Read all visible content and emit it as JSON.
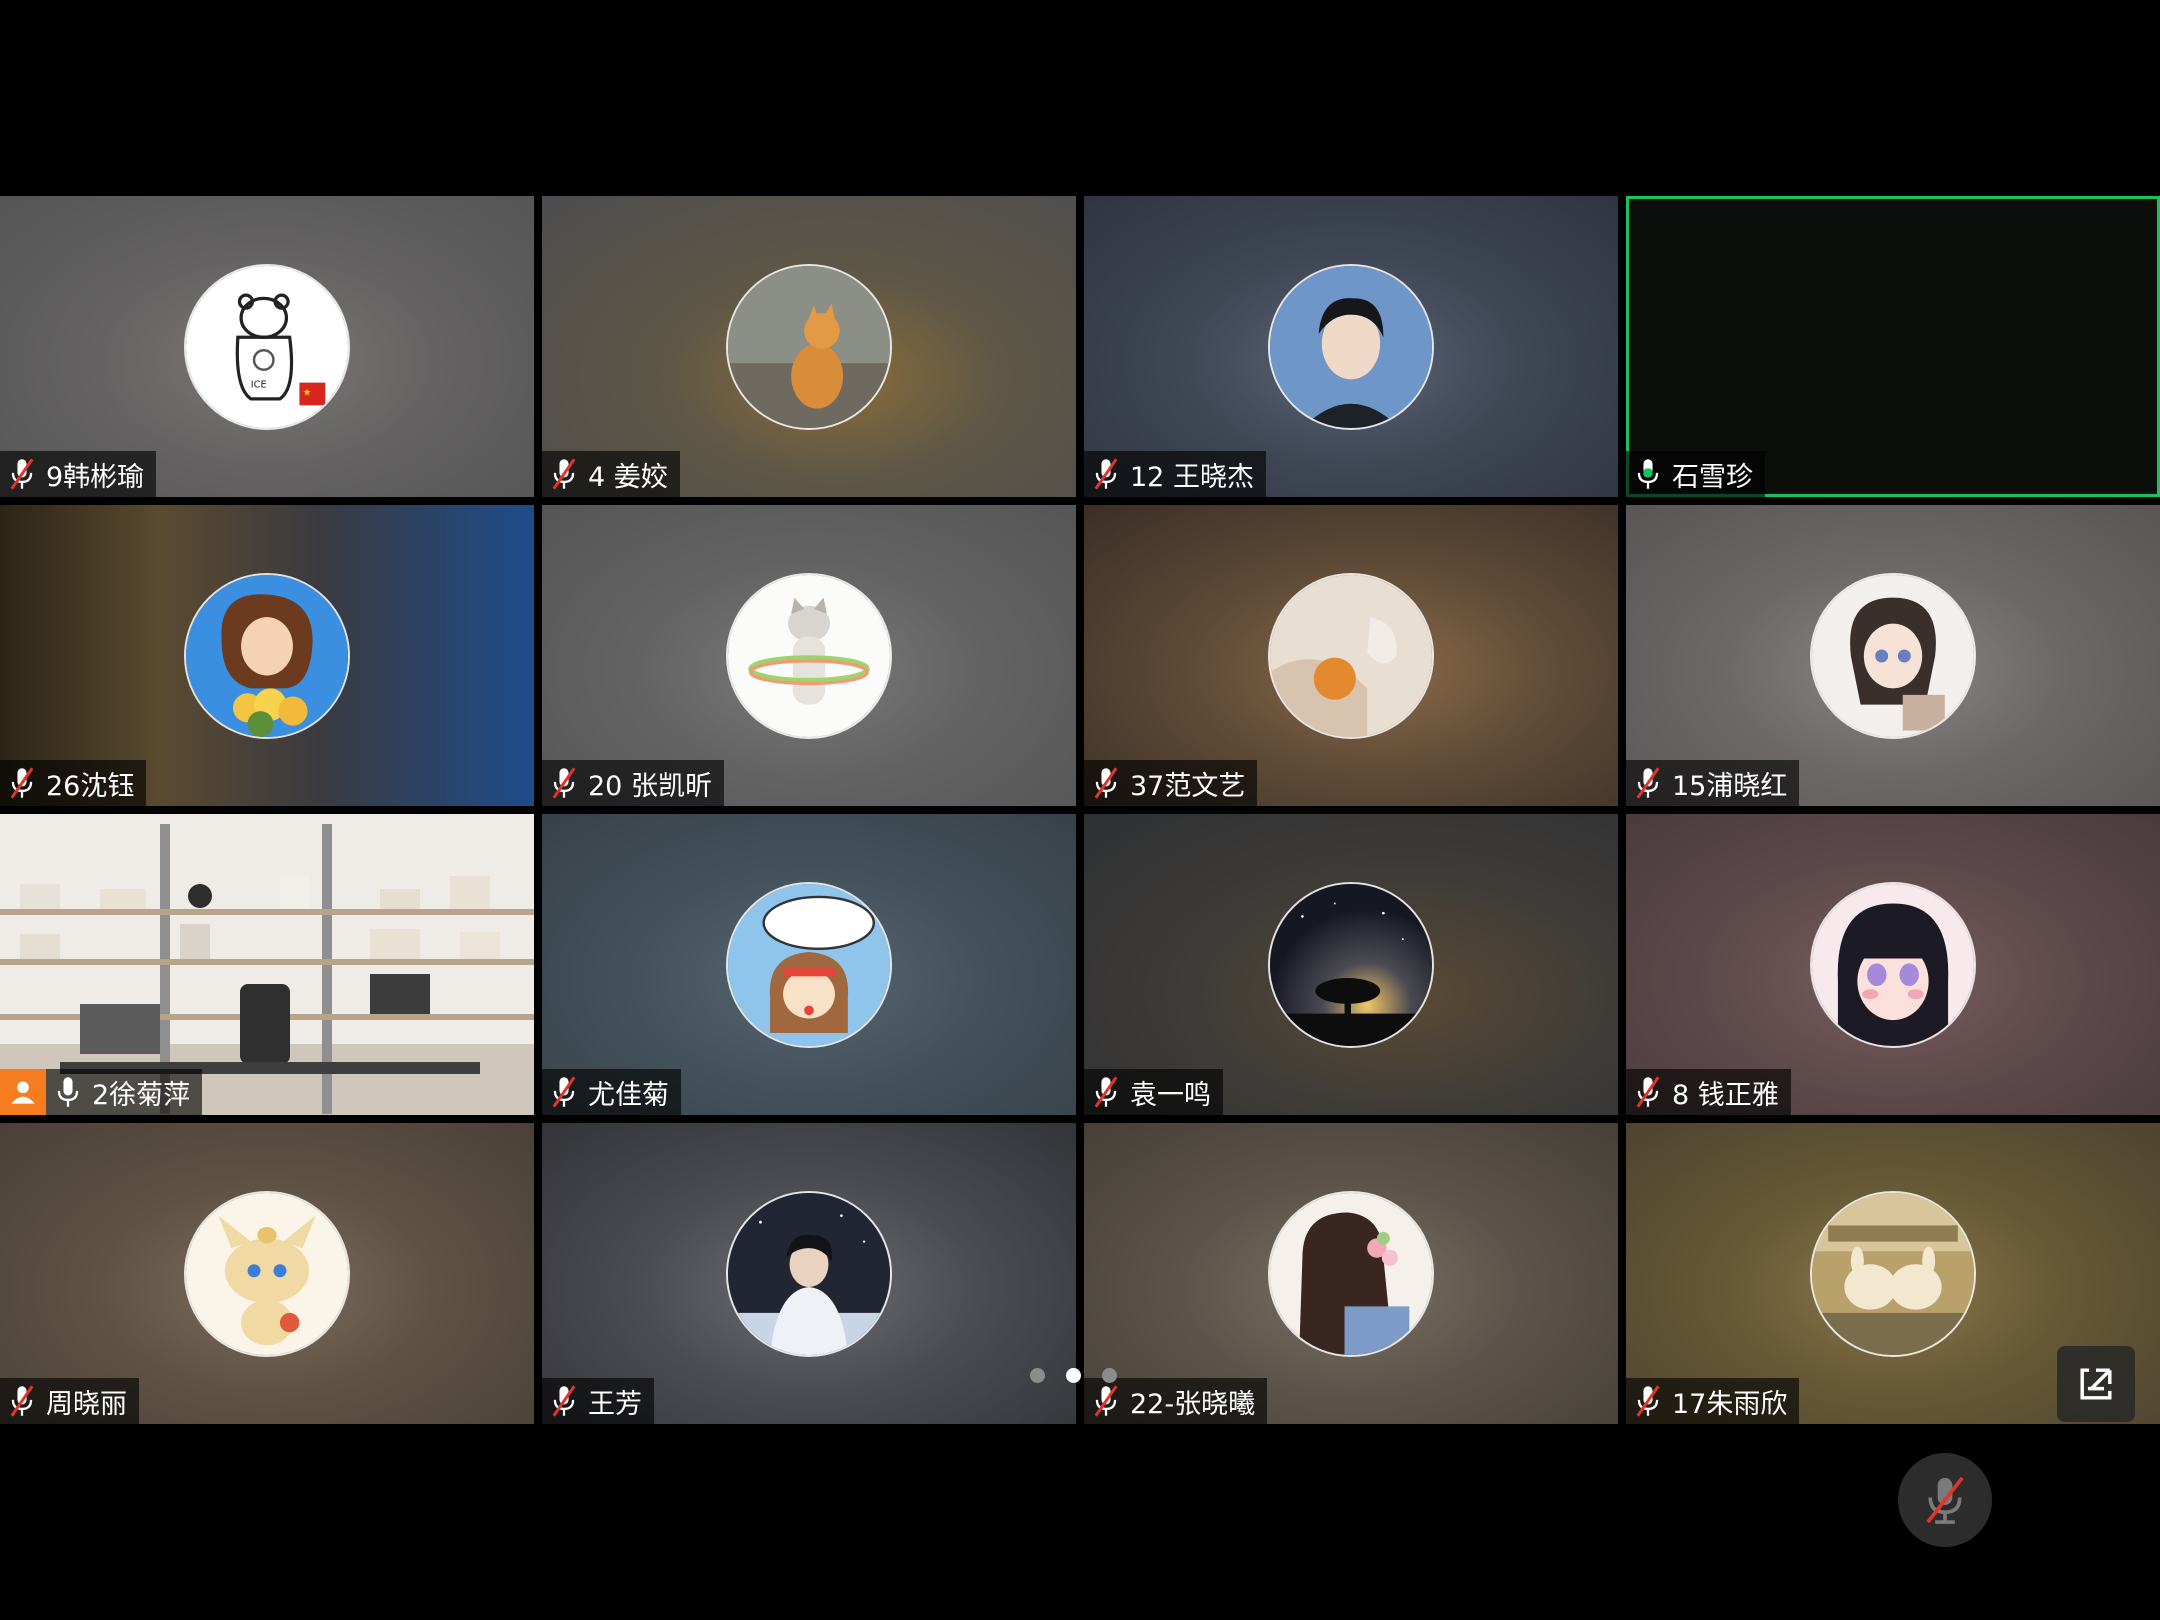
{
  "participants": [
    {
      "name": "9韩彬瑜",
      "mic": "muted",
      "bg": "radial-gradient(ellipse at 50% 55%, #7d7777 0%, #646262 45%, #555555 100%)",
      "avatar": "polar-bear-icon",
      "accent": "#ffffff"
    },
    {
      "name": "4 姜姣",
      "mic": "muted",
      "bg": "radial-gradient(ellipse at 55% 60%, #8a6d3a 0%, #5e5746 40%, #4d4d50 100%)",
      "avatar": "orange-cat-icon",
      "accent": "#d98c3a"
    },
    {
      "name": "12 王晓杰",
      "mic": "muted",
      "bg": "radial-gradient(ellipse at 50% 55%, #5a6478 0%, #3f4654 45%, #2f3540 100%)",
      "avatar": "young-man-icon",
      "accent": "#5b7fb5"
    },
    {
      "name": "石雪珍",
      "mic": "on",
      "bg": "#0c0e0c",
      "avatar": "",
      "accent": "#19c25b",
      "active": true
    },
    {
      "name": "26沈钰",
      "mic": "muted",
      "bg": "linear-gradient(90deg, #2c2416 0%, #5a4a30 30%, #3a3a40 60%, #1d4c8a 100%)",
      "avatar": "girl-flowers-icon",
      "accent": "#f4c542"
    },
    {
      "name": "20 张凯昕",
      "mic": "muted",
      "bg": "radial-gradient(ellipse at 50% 55%, #7a7a7a 0%, #636363 45%, #555555 100%)",
      "avatar": "cat-hula-hoop-icon",
      "accent": "#e8e8e8"
    },
    {
      "name": "37范文艺",
      "mic": "muted",
      "bg": "radial-gradient(ellipse at 55% 55%, #8a6a4a 0%, #5e4a36 45%, #3a2e25 100%)",
      "avatar": "orange-fruit-icon",
      "accent": "#e3a250"
    },
    {
      "name": "15浦晓红",
      "mic": "muted",
      "bg": "radial-gradient(ellipse at 50% 55%, #8a8484 0%, #6d6868 45%, #5a5555 100%)",
      "avatar": "anime-girl-icon",
      "accent": "#bfa79a"
    },
    {
      "name": "2徐菊萍",
      "mic": "on",
      "host": true,
      "bg": "linear-gradient(180deg, #f1efec 0%, #e6e1da 60%, #c9c1b6 100%)",
      "avatar": "",
      "accent": "#f57c1f",
      "video": true
    },
    {
      "name": "尤佳菊",
      "mic": "muted",
      "bg": "radial-gradient(ellipse at 50% 55%, #556672 0%, #44525c 45%, #384148 100%)",
      "avatar": "cartoon-girl-icon",
      "accent": "#8fc4ec"
    },
    {
      "name": "袁一鸣",
      "mic": "muted",
      "bg": "radial-gradient(ellipse at 60% 60%, #5a4a34 0%, #3f3c38 45%, #2e3033 100%)",
      "avatar": "tree-night-sky-icon",
      "accent": "#d6a050"
    },
    {
      "name": "8 钱正雅",
      "mic": "muted",
      "bg": "radial-gradient(ellipse at 50% 55%, #7a5d5f 0%, #5f4a4c 45%, #493b3c 100%)",
      "avatar": "pink-anime-girl-icon",
      "accent": "#f1a6b6"
    },
    {
      "name": "周晓丽",
      "mic": "muted",
      "bg": "radial-gradient(ellipse at 50% 55%, #7d6c5c 0%, #5e5244 45%, #4a4036 100%)",
      "avatar": "meowth-icon",
      "accent": "#e7c36e"
    },
    {
      "name": "王芳",
      "mic": "muted",
      "bg": "radial-gradient(ellipse at 50% 55%, #6a6c72 0%, #4a4c52 45%, #333438 100%)",
      "avatar": "skater-icon",
      "accent": "#c9d4e6"
    },
    {
      "name": "22-张晓曦",
      "mic": "muted",
      "bg": "radial-gradient(ellipse at 50% 55%, #7a7064 0%, #5c544a 45%, #463f38 100%)",
      "avatar": "long-hair-girl-icon",
      "accent": "#5c3b2e"
    },
    {
      "name": "17朱雨欣",
      "mic": "muted",
      "bg": "radial-gradient(ellipse at 50% 55%, #8a7648 0%, #665836 45%, #4d4430 100%)",
      "avatar": "cream-bunnies-icon",
      "accent": "#e9dcb6"
    }
  ],
  "pagination": {
    "current": 2,
    "total": 3
  },
  "controls": {
    "share": "share-screen-icon",
    "mute": "mic-off-icon"
  }
}
